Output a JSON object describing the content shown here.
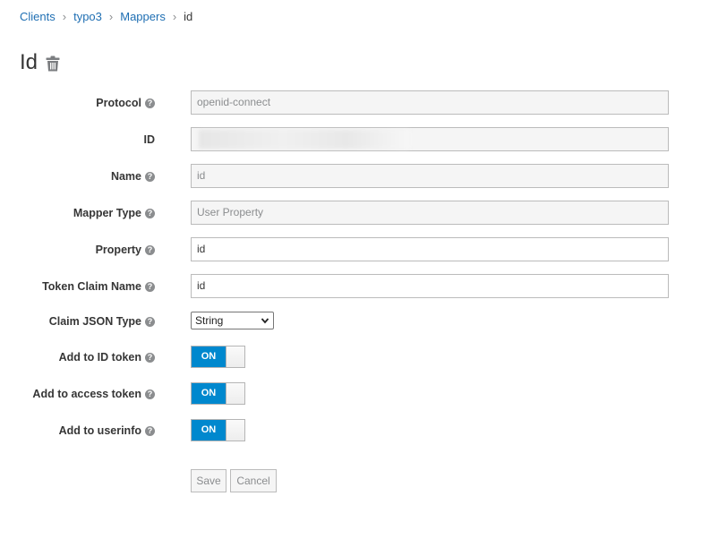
{
  "breadcrumb": {
    "items": [
      {
        "label": "Clients"
      },
      {
        "label": "typo3"
      },
      {
        "label": "Mappers"
      }
    ],
    "separator": "›",
    "current": "id"
  },
  "page": {
    "title": "Id"
  },
  "form": {
    "protocol": {
      "label": "Protocol",
      "value": "openid-connect"
    },
    "id": {
      "label": "ID",
      "value": ""
    },
    "name": {
      "label": "Name",
      "value": "id"
    },
    "mapper_type": {
      "label": "Mapper Type",
      "value": "User Property"
    },
    "property": {
      "label": "Property",
      "value": "id"
    },
    "token_claim_name": {
      "label": "Token Claim Name",
      "value": "id"
    },
    "claim_json_type": {
      "label": "Claim JSON Type",
      "value": "String"
    },
    "add_to_id_token": {
      "label": "Add to ID token",
      "state": "ON"
    },
    "add_to_access_token": {
      "label": "Add to access token",
      "state": "ON"
    },
    "add_to_userinfo": {
      "label": "Add to userinfo",
      "state": "ON"
    }
  },
  "help_glyph": "?",
  "actions": {
    "save": "Save",
    "cancel": "Cancel"
  },
  "colors": {
    "accent": "#0088ce",
    "link": "#1f6fb3"
  },
  "icons": {
    "delete": "trash-icon",
    "help": "question-circle-icon"
  }
}
